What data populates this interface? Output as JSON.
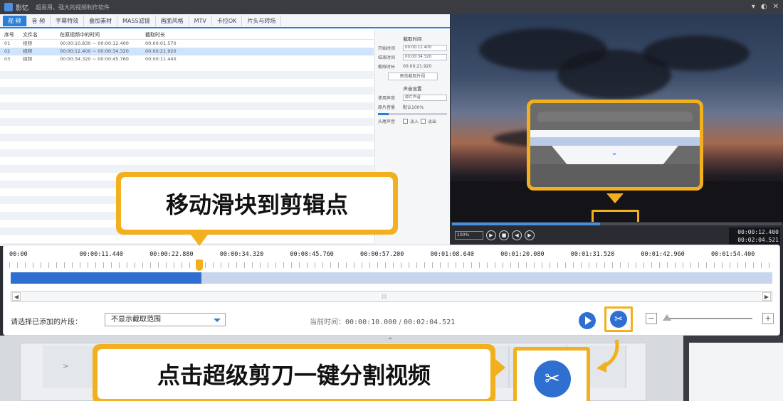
{
  "titlebar": {
    "app_name": "影忆",
    "window_title": "超易用、强大的视频制作软件",
    "controls": [
      "▾",
      "◐",
      "✕"
    ]
  },
  "tabs": [
    {
      "label": "视 频",
      "active": true
    },
    {
      "label": "音 频"
    },
    {
      "label": "字幕特效"
    },
    {
      "label": "叠加素材"
    },
    {
      "label": "MASS滤镜"
    },
    {
      "label": "画面风格"
    },
    {
      "label": "MTV"
    },
    {
      "label": "卡拉OK"
    },
    {
      "label": "片头与转场"
    }
  ],
  "table": {
    "headers": [
      "序号",
      "文件名",
      "在原视频中的时间",
      "截取时长"
    ],
    "rows": [
      [
        "01",
        "视频",
        "00:00:10.830 ~ 00:00:12.400",
        "00:00:01.570"
      ],
      [
        "02",
        "视频",
        "00:00:12.400 ~ 00:00:34.320",
        "00:00:21.920"
      ],
      [
        "03",
        "视频",
        "00:00:34.320 ~ 00:00:45.760",
        "00:00:11.440"
      ]
    ],
    "selected_row": 1
  },
  "settings": {
    "section1_title": "截取时间",
    "start_label": "开始时间",
    "start_value": "00:00:12.400",
    "end_label": "结束时间",
    "end_value": "00:00:34.320",
    "duration_label": "截取时长",
    "duration_value": "00:00:21.920",
    "preview_button": "预览截取片段",
    "section2_title": "声音设置",
    "sound_label": "使用声音",
    "sound_value": "原片声音",
    "volume_label": "原片音量",
    "volume_hint": "默认100%",
    "fade_label": "头尾声音",
    "fade_in": "淡入",
    "fade_out": "淡出"
  },
  "preview": {
    "zoom_value": "100%",
    "current_time": "00:00:12.400",
    "total_time": "00:02:04.521",
    "progress_fraction": 0.45
  },
  "timeline": {
    "ticks": [
      "00:00",
      "00:00:11.440",
      "00:00:22.880",
      "00:00:34.320",
      "00:00:45.760",
      "00:00:57.200",
      "00:01:08.640",
      "00:01:20.080",
      "00:01:31.520",
      "00:01:42.960",
      "00:01:54.400"
    ],
    "played_fraction": 0.25,
    "scroll_left": "◀",
    "scroll_right": "▶",
    "scroll_grip": "|||",
    "clip_select_label": "请选择已添加的片段：",
    "clip_select_value": "不显示截取范围",
    "time_label": "当前时间：",
    "time_current": "00:00:10.000",
    "time_separator": " / ",
    "time_total": "00:02:04.521",
    "zoom_minus": "−",
    "zoom_plus": "+"
  },
  "callouts": {
    "move_slider": "移动滑块到剪辑点",
    "click_cut": "点击超级剪刀一键分割视频"
  },
  "icons": {
    "scissors": "✂",
    "chevron_down": "⌄",
    "chevron_up": "⌃",
    "chevron_right": ">"
  },
  "colors": {
    "accent_blue": "#2f6fd0",
    "highlight_yellow": "#f2b01e"
  }
}
